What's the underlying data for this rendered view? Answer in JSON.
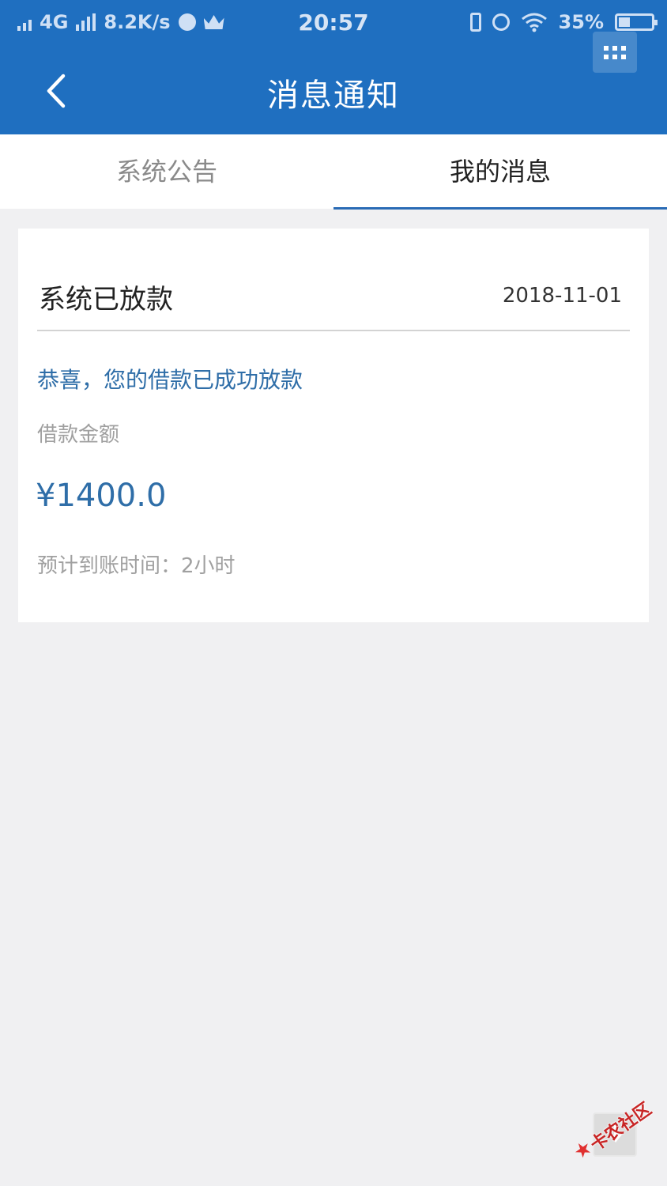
{
  "status_bar": {
    "network": "4G",
    "speed": "8.2K/s",
    "time": "20:57",
    "battery": "35%",
    "battery_level": 0.35,
    "icons": [
      "signal-icon",
      "chat-bubble-icon",
      "crown-icon",
      "vibrate-icon",
      "alarm-icon",
      "wifi-icon",
      "battery-icon"
    ]
  },
  "header": {
    "title": "消息通知",
    "back_icon": "chevron-left-icon",
    "menu_icon": "grid-icon",
    "background_color": "#1f6fc0"
  },
  "tabs": [
    {
      "label": "系统公告",
      "active": false
    },
    {
      "label": "我的消息",
      "active": true
    }
  ],
  "message": {
    "title": "系统已放款",
    "date": "2018-11-01",
    "headline": "恭喜，您的借款已成功放款",
    "amount_label": "借款金额",
    "amount": "¥1400.0",
    "arrival": "预计到账时间：2小时"
  },
  "watermark": {
    "text": "卡农社区"
  },
  "colors": {
    "accent": "#2f6ea8",
    "tab_indicator": "#2a6bb5"
  }
}
